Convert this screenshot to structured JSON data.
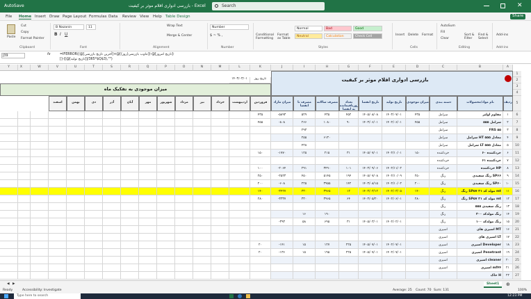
{
  "titlebar": {
    "autosave": "AutoSave",
    "doc_title": "بازرسی ادواری اقلام موثر بر کیفیت - Excel",
    "search_placeholder": "Search"
  },
  "menu": {
    "file": "File",
    "home": "Home",
    "insert": "Insert",
    "draw": "Draw",
    "page_layout": "Page Layout",
    "formulas": "Formulas",
    "data": "Data",
    "review": "Review",
    "view": "View",
    "help": "Help",
    "table_design": "Table Design",
    "share": "Share"
  },
  "ribbon": {
    "paste": "Paste",
    "cut": "Cut",
    "copy": "Copy",
    "format_painter": "Format Painter",
    "font_name": "B Nazanin",
    "font_size": "11",
    "wrap_text": "Wrap Text",
    "merge_center": "Merge & Center",
    "number_format": "Number",
    "conditional": "Conditional Formatting",
    "format_table": "Format as Table",
    "style_normal": "Normal",
    "style_bad": "Bad",
    "style_good": "Good",
    "style_neutral": "Neutral",
    "style_calculation": "Calculation",
    "style_check": "Check Cell",
    "insert": "Insert",
    "delete": "Delete",
    "format": "Format",
    "autosum": "AutoSum",
    "fill": "Fill",
    "clear": "Clear",
    "sort_filter": "Sort & Filter",
    "find_select": "Find & Select",
    "addins": "Add-ins",
    "groups": {
      "clipboard": "Clipboard",
      "font": "Font",
      "alignment": "Alignment",
      "number": "Number",
      "styles": "Styles",
      "cells": "Cells",
      "editing": "Editing",
      "addins": "Add-ins"
    }
  },
  "formula_bar": {
    "name_box": "J39",
    "fx": "fx",
    "line1": "=IFERROR((@[آخرین تاریخ بازرسی]+@[تناوب بازرسی(روز)])-@[تاریخ امروز]؛",
    "line2": "[]-([@[تاریخ تولید]]/365*$Q$3),\"\")"
  },
  "columns": [
    "A",
    "B",
    "C",
    "D",
    "E",
    "F",
    "G",
    "H",
    "I",
    "J",
    "K",
    "L",
    "M",
    "N",
    "O",
    "P",
    "Q",
    "R",
    "S",
    "T",
    "U",
    "V",
    "W",
    "X",
    "Y",
    "Z",
    "AA",
    "AB"
  ],
  "sheet": {
    "main_title": "بازرسی ادواری اقلام موثر بر کیفیت",
    "today_label": "تاریخ روز",
    "today_value": "۱۴۰۳/۰۳/۰۱",
    "days_label": "تعداد روز باقیمانده تا آخر سال",
    "days_value": "۲۲۳",
    "monthly_title": "میزان موجودی به تفکیک ماه",
    "headers": [
      "ردیف",
      "نام مواد/محصولات",
      "دسته بندی",
      "میزان موجودی",
      "تاریخ تولید",
      "تاریخ انقضا",
      "تعداد روزباقیمانده به انقضا",
      "مصرف سالانه",
      "مصرف تا انقضا",
      "میزان مازاد"
    ],
    "months": [
      "فروردین",
      "اردیبهشت",
      "خرداد",
      "تیر",
      "مرداد",
      "شهریور",
      "مهر",
      "آبان",
      "آذر",
      "دی",
      "بهمن",
      "اسفند"
    ],
    "rows": [
      {
        "n": "۱",
        "name": "مقاوم اولتر",
        "cat": "سرامل",
        "qty": "۴۳۵",
        "prod": "۱۴۰۳/۰۷/۰۱",
        "exp": "۱۴۰۵/۰۸/۰۸",
        "days": "۴۵۲",
        "year": "۴۳۵",
        "use": "۵۲۹",
        "surplus": "-۵۸۹۳",
        "m1": "۴۳۵"
      },
      {
        "n": "۲",
        "name": "سرامل ۵۵۵",
        "cat": "سرامل",
        "qty": "۴۵۵",
        "prod": "۱۴۰۲/۰۶/۰۱",
        "exp": "۱۴۰۳/۰۶/۰۱",
        "days": "۹۰",
        "year": "۱۰۸۰",
        "use": "۲۶۶",
        "surplus": "-۸۰۸",
        "m1": "۴۵۵"
      },
      {
        "n": "۳",
        "name": "FRS ۵۵",
        "cat": "سرامل",
        "qty": "",
        "prod": "",
        "exp": "",
        "days": "",
        "year": "",
        "use": "۲۹۳",
        "surplus": "",
        "m1": ""
      },
      {
        "n": "۴",
        "name": "سرامل HT معادل ۵۵۵",
        "cat": "سرامل",
        "qty": "",
        "prod": "",
        "exp": "",
        "days": "",
        "year": "۶۱۳۰",
        "use": "۲۵۵",
        "surplus": "",
        "m1": ""
      },
      {
        "n": "۵",
        "name": "سرامل LT معادل ۵۵۵",
        "cat": "سرامل",
        "qty": "",
        "prod": "",
        "exp": "",
        "days": "",
        "year": "",
        "use": "۴۲۸",
        "surplus": "",
        "m1": ""
      },
      {
        "n": "۶",
        "name": "خردکننده ۶۰",
        "cat": "خردکننده",
        "qty": "۱۵۰",
        "prod": "۱۴۰۲/۱۰/۰۱",
        "exp": "۱۴۰۵/۰۷/۰۱",
        "days": "۳۱",
        "year": "۲۱۵",
        "use": "۱۲۵",
        "surplus": "-۱۷۷۰",
        "m1": "۱۵۰"
      },
      {
        "n": "۷",
        "name": "خردکننده ۶۱",
        "cat": "خردکننده",
        "qty": "",
        "prod": "",
        "exp": "",
        "days": "",
        "year": "",
        "use": "",
        "surplus": "",
        "m1": ""
      },
      {
        "n": "۸",
        "name": "خردکننده HP",
        "cat": "خردکننده",
        "qty": "",
        "prod": "۱۴۰۲/۱۱/۰۲",
        "exp": "۱۴۰۳/۰۹/۰۶",
        "days": "۱۰۱",
        "year": "۳۴۹۰",
        "use": "۲۹۱",
        "surplus": "-۲۰۶۴",
        "m1": "۱۰۰"
      },
      {
        "n": "۹",
        "name": "رنگ سفیدی SP۶۶",
        "cat": "رنگ",
        "qty": "۲۵۰",
        "prod": "۱۴۰۲/۱۰/۰۹",
        "exp": "۱۴۰۵/۰۷/۰۸",
        "days": "۱۹۴",
        "year": "۵۱۴۵",
        "use": "۴۵۰",
        "surplus": "-۲۵۲۳",
        "m1": "۲۵۰"
      },
      {
        "n": "۱۰",
        "name": "رنگ سفیدی SP۶۰",
        "cat": "رنگ",
        "qty": "۲۰۰",
        "prod": "۱۴۰۲/۱۰/۰۲",
        "exp": "۱۴۰۳/۰۸/۱۵",
        "days": "۱۴۲",
        "year": "۳۹۵۵",
        "use": "۲۲۵",
        "surplus": "-۶۰۸",
        "m1": "۲۰۰"
      },
      {
        "n": "۱۱",
        "name": "رنگ SP۵۷ مولد کد ۳۱ mt",
        "cat": "رنگ",
        "qty": "۱۴۰",
        "prod": "۱۴۰۲/۰۳/۰۵",
        "exp": "۱۴۰۳/۰۳/۱۲",
        "days": "۱۲",
        "year": "۳۹۶۵",
        "use": "۳۳۰",
        "surplus": "-۳۴۲۷",
        "m1": "۱۴۰",
        "hl": true
      },
      {
        "n": "۱۲",
        "name": "رنگ SP۵۷ مولد کد ۳۱ mt",
        "cat": "رنگ",
        "qty": "۲۸۰",
        "prod": "۱۴۰۲/۰۶/۰۱",
        "exp": "۱۴۰۳/۰۵/۲۰",
        "days": "۶۴",
        "year": "۳۹۶۵",
        "use": "۳۳۰",
        "surplus": "-۳۳۳۷",
        "m1": "۲۸۰"
      },
      {
        "n": "۱۳",
        "name": "رنگ سفیدی ۵۵۵",
        "cat": "رنگ",
        "qty": "",
        "prod": "",
        "exp": "",
        "days": "",
        "year": "",
        "use": "",
        "surplus": "",
        "m1": ""
      },
      {
        "n": "۱۴",
        "name": "رنگ مولدکد ۳۰۰",
        "cat": "رنگ",
        "qty": "",
        "prod": "",
        "exp": "",
        "days": "",
        "year": "۱۹۰",
        "use": "۱۶",
        "surplus": "",
        "m1": ""
      },
      {
        "n": "۱۵",
        "name": "رنگ مولدکد ۱۰۰",
        "cat": "رنگ",
        "qty": "",
        "prod": "۱۴۰۲/۰۲/۰۱",
        "exp": "۱۴۰۵/۰۳/۰۱",
        "days": "۳۱",
        "year": "۶۹۵",
        "use": "۵۸",
        "surplus": "-۳۹۳",
        "m1": ""
      },
      {
        "n": "۱۶",
        "name": "اسپری های MT",
        "cat": "اسپری",
        "qty": "",
        "prod": "",
        "exp": "",
        "days": "",
        "year": "",
        "use": "",
        "surplus": "",
        "m1": ""
      },
      {
        "n": "۱۷",
        "name": "اسپری های LT",
        "cat": "اسپری",
        "qty": "",
        "prod": "",
        "exp": "",
        "days": "",
        "year": "",
        "use": "",
        "surplus": "",
        "m1": ""
      },
      {
        "n": "۱۸",
        "name": "اسپری Developer",
        "cat": "اسپری",
        "qty": "",
        "prod": "۱۴۰۲/۰۷/۰۱",
        "exp": "۱۴۰۵/۰۷/۰۱",
        "days": "۲۲۵",
        "year": "۱۲۷",
        "use": "۱۵",
        "surplus": "-۱۴۱",
        "m1": "۲۰"
      },
      {
        "n": "۱۹",
        "name": "اسپری Penetrant",
        "cat": "اسپری",
        "qty": "",
        "prod": "۱۴۰۲/۰۷/۰۱",
        "exp": "۱۴۰۵/۰۷/۰۱",
        "days": "۲۲۵",
        "year": "۱۹۵",
        "use": "۱۵",
        "surplus": "-۱۳۶",
        "m1": "۲۰"
      },
      {
        "n": "۲۰",
        "name": "اسپری cleaner",
        "cat": "اسپری",
        "qty": "",
        "prod": "",
        "exp": "",
        "days": "",
        "year": "",
        "use": "",
        "surplus": "",
        "m1": ""
      },
      {
        "n": "۲۱",
        "name": "اسپری mf۴۴",
        "cat": "اسپری",
        "qty": "",
        "prod": "",
        "exp": "",
        "days": "",
        "year": "",
        "use": "",
        "surplus": "",
        "m1": ""
      },
      {
        "n": "۲۲",
        "name": "خاک H",
        "cat": "",
        "qty": "",
        "prod": "",
        "exp": "",
        "days": "",
        "year": "",
        "use": "",
        "surplus": "",
        "m1": ""
      }
    ]
  },
  "sheet_tab": "Sheet1",
  "status": {
    "ready": "Ready",
    "accessibility": "Accessibility: Investigate",
    "average": "Average: 25",
    "count": "Count: 70",
    "sum": "Sum: 131",
    "zoom": "100%"
  },
  "taskbar": {
    "search": "Type here to search",
    "time": "12:23 PM"
  }
}
